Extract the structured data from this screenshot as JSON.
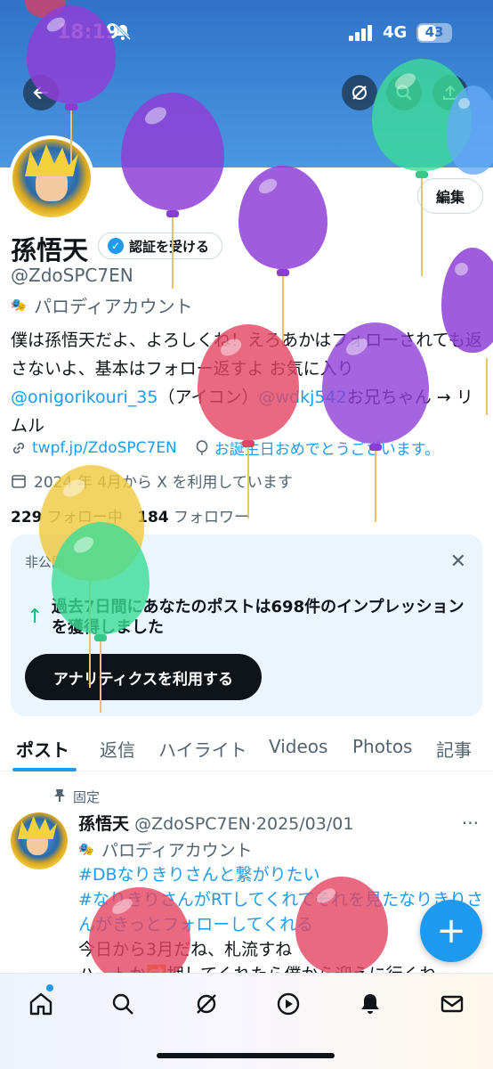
{
  "status_bar": {
    "time": "18:19",
    "network": "4G",
    "battery": "43"
  },
  "profile": {
    "edit_label": "編集",
    "name": "孫悟天",
    "verify_label": "認証を受ける",
    "handle": "@ZdoSPC7EN",
    "parody_label": "パロディアカウント",
    "bio_part1": "僕は孫悟天だよ、よろしくね！えろあかはフォローされても返さないよ、基本はフォロー返すよ お気に入り ",
    "bio_mention1": "@onigorikouri_35",
    "bio_part2": "（アイコン）",
    "bio_mention2": "@wdkj542",
    "bio_part3": "お兄ちゃん → リムル",
    "link": "twpf.jp/ZdoSPC7EN",
    "birthday": "お誕生日おめでとうございます。",
    "joined": "2024 年 4月から X を利用しています",
    "following_count": "229",
    "following_label": "フォロー中",
    "followers_count": "184",
    "followers_label": "フォロワー"
  },
  "analytics_card": {
    "label": "非公開",
    "text": "過去7日間にあなたのポストは698件のインプレッションを獲得しました",
    "button": "アナリティクスを利用する"
  },
  "tabs": [
    "ポスト",
    "返信",
    "ハイライト",
    "Videos",
    "Photos",
    "記事"
  ],
  "post": {
    "pinned_label": "固定",
    "author": "孫悟天",
    "meta": "@ZdoSPC7EN·2025/03/01",
    "parody_label": "パロディアカウント",
    "hashtag1": "#DBなりきりさんと繋がりたい",
    "hashtag2": "#なりきりさんがRTしてくれてそれを見たなりきりさんがきっとフォローしてくれる",
    "line1": "今日から3月だね、札流すね",
    "line2": "ハートか🔁押してくれたら僕から迎えに行くね"
  },
  "colors": {
    "accent": "#1d9bf0",
    "banner": "#3b86d6",
    "text": "#0f1419",
    "muted": "#536471"
  }
}
